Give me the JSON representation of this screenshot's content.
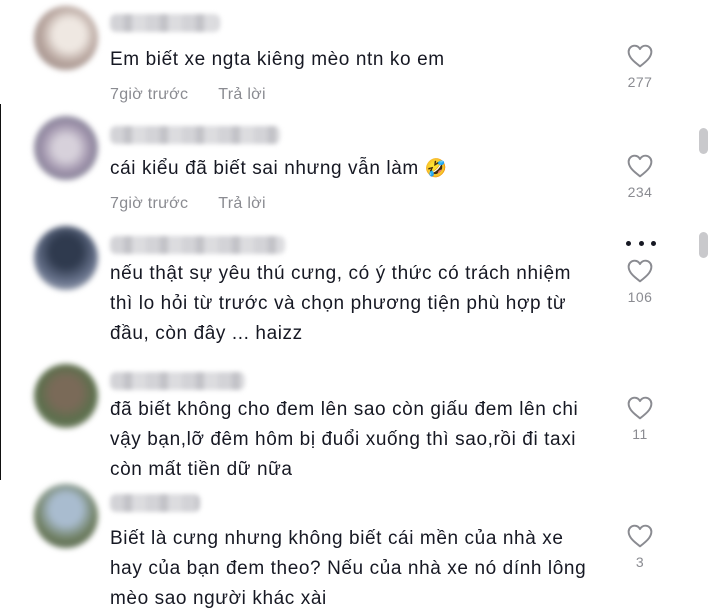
{
  "comments": [
    {
      "lines": [
        "Em biết xe ngta kiêng mèo ntn ko em"
      ],
      "time": "7giờ trước",
      "reply_label": "Trả lời",
      "likes": "277"
    },
    {
      "lines": [
        "cái kiểu đã biết sai nhưng vẫn làm"
      ],
      "emoji": "🤣",
      "time": "7giờ trước",
      "reply_label": "Trả lời",
      "likes": "234"
    },
    {
      "lines": [
        "nếu thật sự yêu thú cưng, có ý thức có trách nhiệm",
        "thì lo hỏi từ trước và chọn phương tiện phù hợp từ",
        "đầu, còn đây ... haizz"
      ],
      "likes": "106"
    },
    {
      "lines": [
        "đã biết không cho đem lên sao còn giấu đem lên chi",
        "vậy bạn,lỡ đêm hôm bị đuổi xuống thì sao,rồi đi taxi",
        "còn mất tiền dữ nữa"
      ],
      "likes": "11"
    },
    {
      "lines": [
        "Biết là cưng nhưng không biết cái mền của nhà xe",
        "hay của bạn đem theo? Nếu của nhà xe nó dính lông",
        "mèo sao người khác xài"
      ],
      "likes": "3"
    }
  ],
  "icons": {
    "like": "heart-outline-icon",
    "more": "more-horizontal-icon"
  },
  "colors": {
    "text": "#161823",
    "secondary": "#8a8b91",
    "background": "#ffffff"
  }
}
